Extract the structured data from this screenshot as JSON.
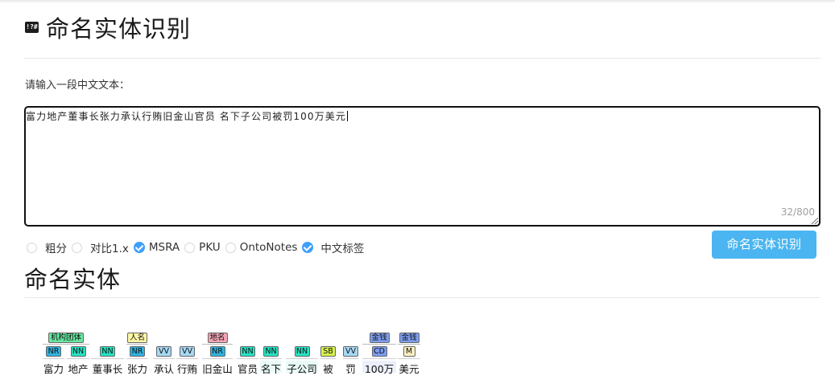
{
  "title": {
    "icon": "!?#",
    "text": "命名实体识别"
  },
  "input": {
    "label": "请输入一段中文文本：",
    "value": "富力地产董事长张力承认行贿旧金山官员 名下子公司被罚100万美元",
    "counter": "32/800"
  },
  "options": [
    {
      "label": "粗分",
      "checked": false
    },
    {
      "label": "对比1.x",
      "checked": false
    },
    {
      "label": "MSRA",
      "checked": true
    },
    {
      "label": "PKU",
      "checked": false
    },
    {
      "label": "OntoNotes",
      "checked": false
    },
    {
      "label": "中文标签",
      "checked": true
    }
  ],
  "submit_label": "命名实体识别",
  "result_heading": "命名实体",
  "colors": {
    "NR": "#2fb3e0",
    "NN": "#25e3c3",
    "VV": "#a6d8f5",
    "SB": "#d7f04d",
    "CD": "#7b9cf1",
    "M": "#fdf0c2",
    "ent_org": "#69e8a2",
    "ent_person": "#fdf6a5",
    "ent_location": "#f2a3b2",
    "ent_money": "#7f9ef0",
    "accent": "#4ab5f0"
  },
  "tokens": [
    {
      "text": "富力",
      "pos": "NR"
    },
    {
      "text": "地产",
      "pos": "NN"
    },
    {
      "text": "董事长",
      "pos": "NN"
    },
    {
      "text": "张力",
      "pos": "NR"
    },
    {
      "text": "承认",
      "pos": "VV"
    },
    {
      "text": "行贿",
      "pos": "VV"
    },
    {
      "text": "旧金山",
      "pos": "NR"
    },
    {
      "text": "官员",
      "pos": "NN"
    },
    {
      "text": "名下",
      "pos": "NN"
    },
    {
      "text": "子公司",
      "pos": "NN"
    },
    {
      "text": "被",
      "pos": "SB"
    },
    {
      "text": "罚",
      "pos": "VV"
    },
    {
      "text": "100万",
      "pos": "CD"
    },
    {
      "text": "美元",
      "pos": "M"
    }
  ],
  "entities": [
    {
      "label": "机构团体",
      "type": "ent_org",
      "start": 0,
      "end": 1
    },
    {
      "label": "人名",
      "type": "ent_person",
      "start": 3,
      "end": 3
    },
    {
      "label": "地名",
      "type": "ent_location",
      "start": 6,
      "end": 6
    },
    {
      "label": "金钱",
      "type": "ent_money",
      "start": 12,
      "end": 12
    },
    {
      "label": "金钱",
      "type": "ent_money",
      "start": 13,
      "end": 13
    }
  ]
}
